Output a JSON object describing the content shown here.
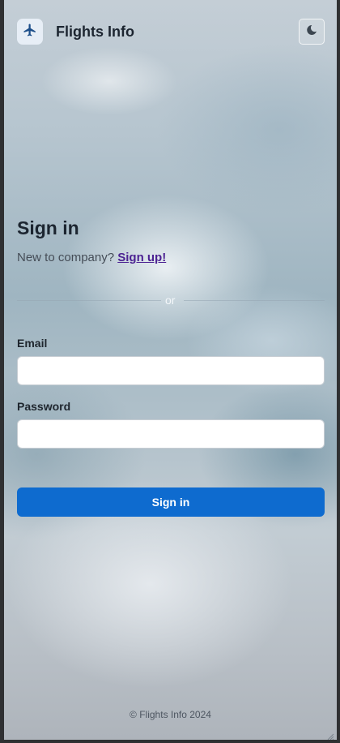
{
  "header": {
    "app_title": "Flights Info",
    "logo_icon": "airplane-icon",
    "theme_toggle_icon": "moon-icon"
  },
  "signin": {
    "title": "Sign in",
    "new_to_company": "New to company?",
    "signup_link": "Sign up!",
    "divider": "or",
    "email_label": "Email",
    "email_value": "",
    "password_label": "Password",
    "password_value": "",
    "submit_label": "Sign in"
  },
  "footer": {
    "text": "© Flights Info 2024"
  },
  "colors": {
    "accent": "#0e6bcf",
    "link": "#4c2292",
    "logo_tile": "#e7eef6",
    "logo_icon": "#1d4f8a"
  }
}
